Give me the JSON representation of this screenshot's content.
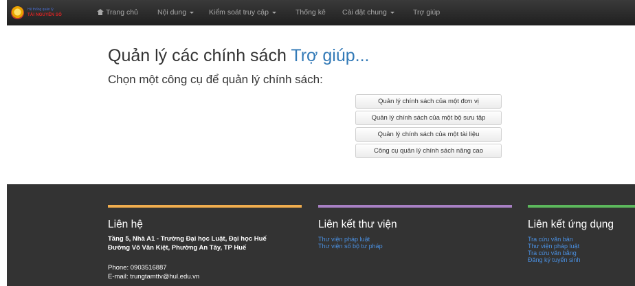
{
  "brand": {
    "small": "Hệ thống quản lý",
    "name": "TÀI NGUYÊN SỐ"
  },
  "nav": {
    "home": "Trang chủ",
    "content": "Nội dung",
    "access_control": "Kiểm soát truy cập",
    "statistics": "Thống kê",
    "settings": "Cài đặt chung",
    "help": "Trợ giúp"
  },
  "main": {
    "title": "Quản lý các chính sách",
    "title_help": "Trợ giúp...",
    "subtitle": "Chọn một công cụ để quản lý chính sách:",
    "buttons": [
      "Quản lý chính sách của một đơn vị",
      "Quản lý chính sách của một bộ sưu tập",
      "Quản lý chính sách của một tài liệu",
      "Công cụ quản lý chính sách nâng cao"
    ]
  },
  "footer": {
    "contact": {
      "heading": "Liên hệ",
      "address_line1": "Tầng 5, Nhà A1 - Trường Đại học Luật, Đại học Huế",
      "address_line2": "Đường Võ Văn Kiệt, Phường An Tây, TP Huế",
      "phone": "Phone: 0903516887",
      "email": "E-mail: trungtamttv@hul.edu.vn"
    },
    "library_links": {
      "heading": "Liên kết thư viện",
      "items": [
        "Thư viện pháp luật",
        "Thư viện số bộ tư pháp"
      ]
    },
    "app_links": {
      "heading": "Liên kết ứng dụng",
      "items": [
        "Tra cứu văn bản",
        "Thư viện pháp luật",
        "Tra cứu văn bằng",
        "Đăng ký tuyển sinh"
      ]
    }
  },
  "colors": {
    "accent_link": "#337ab7",
    "bar_contact": "#f0ad4e",
    "bar_library": "#a880c4",
    "bar_apps": "#5cb85c"
  }
}
